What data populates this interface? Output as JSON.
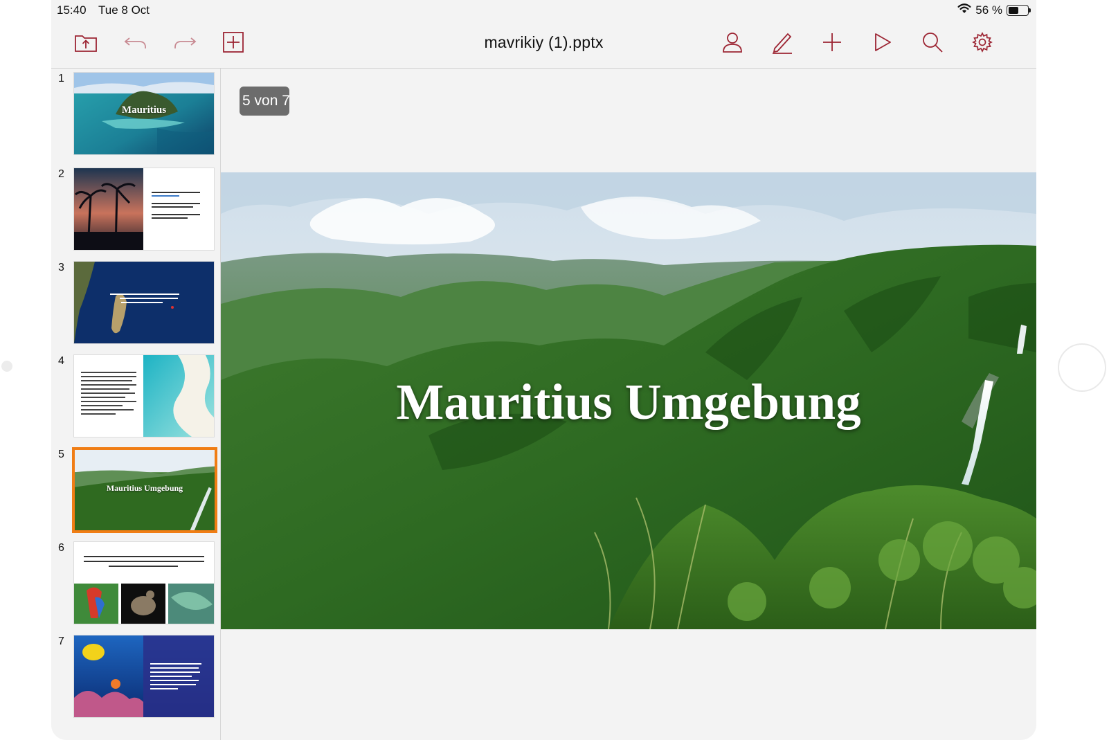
{
  "statusbar": {
    "time": "15:40",
    "date": "Tue 8 Oct",
    "battery_text": "56 %",
    "battery_level": 0.56
  },
  "toolbar": {
    "title": "mavrikiy (1).pptx",
    "icons": [
      "folder-upload-icon",
      "undo-icon",
      "redo-icon",
      "add-slide-icon",
      "user-icon",
      "pen-icon",
      "plus-icon",
      "play-icon",
      "search-icon",
      "gear-icon"
    ],
    "accent_color": "#9c2432"
  },
  "sidebar": {
    "slides": [
      {
        "number": "1",
        "title": "Mauritius"
      },
      {
        "number": "2",
        "title": ""
      },
      {
        "number": "3",
        "title": ""
      },
      {
        "number": "4",
        "title": ""
      },
      {
        "number": "5",
        "title": "Mauritius Umgebung",
        "selected": true
      },
      {
        "number": "6",
        "title": ""
      },
      {
        "number": "7",
        "title": ""
      }
    ],
    "selected_color": "#f07d14"
  },
  "main": {
    "page_indicator": "5 von 7",
    "slide_title": "Mauritius Umgebung"
  }
}
